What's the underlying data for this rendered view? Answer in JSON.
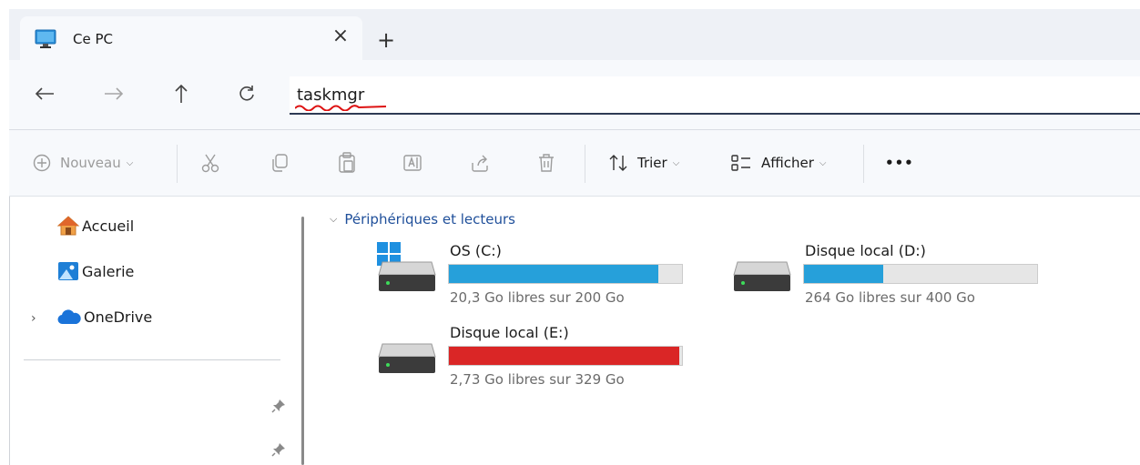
{
  "window": {
    "tab_title": "Ce PC",
    "close_tab_glyph": "×",
    "new_tab_glyph": "+"
  },
  "address_bar": {
    "value": "taskmgr"
  },
  "toolbar": {
    "new_label": "Nouveau",
    "sort_label": "Trier",
    "view_label": "Afficher",
    "more_glyph": "•••"
  },
  "sidebar": {
    "items": [
      {
        "label": "Accueil",
        "icon": "home-icon"
      },
      {
        "label": "Galerie",
        "icon": "gallery-icon"
      },
      {
        "label": "OneDrive",
        "icon": "onedrive-cloud-icon"
      }
    ],
    "expander_glyph": "›"
  },
  "content": {
    "group_title": "Périphériques et lecteurs",
    "drives": [
      {
        "name": "OS (C:)",
        "free_text": "20,3 Go libres sur 200 Go",
        "used_fraction": 0.9,
        "bar_color": "#26a0da",
        "icon": "windows-drive-icon"
      },
      {
        "name": "Disque local (D:)",
        "free_text": "264 Go libres sur 400 Go",
        "used_fraction": 0.34,
        "bar_color": "#26a0da",
        "icon": "hard-drive-icon"
      },
      {
        "name": "Disque local (E:)",
        "free_text": "2,73 Go libres sur 329 Go",
        "used_fraction": 0.99,
        "bar_color": "#da2626",
        "icon": "hard-drive-icon"
      }
    ]
  },
  "colors": {
    "accent": "#26a0da",
    "critical": "#da2626",
    "group_header": "#1f4f9a"
  }
}
